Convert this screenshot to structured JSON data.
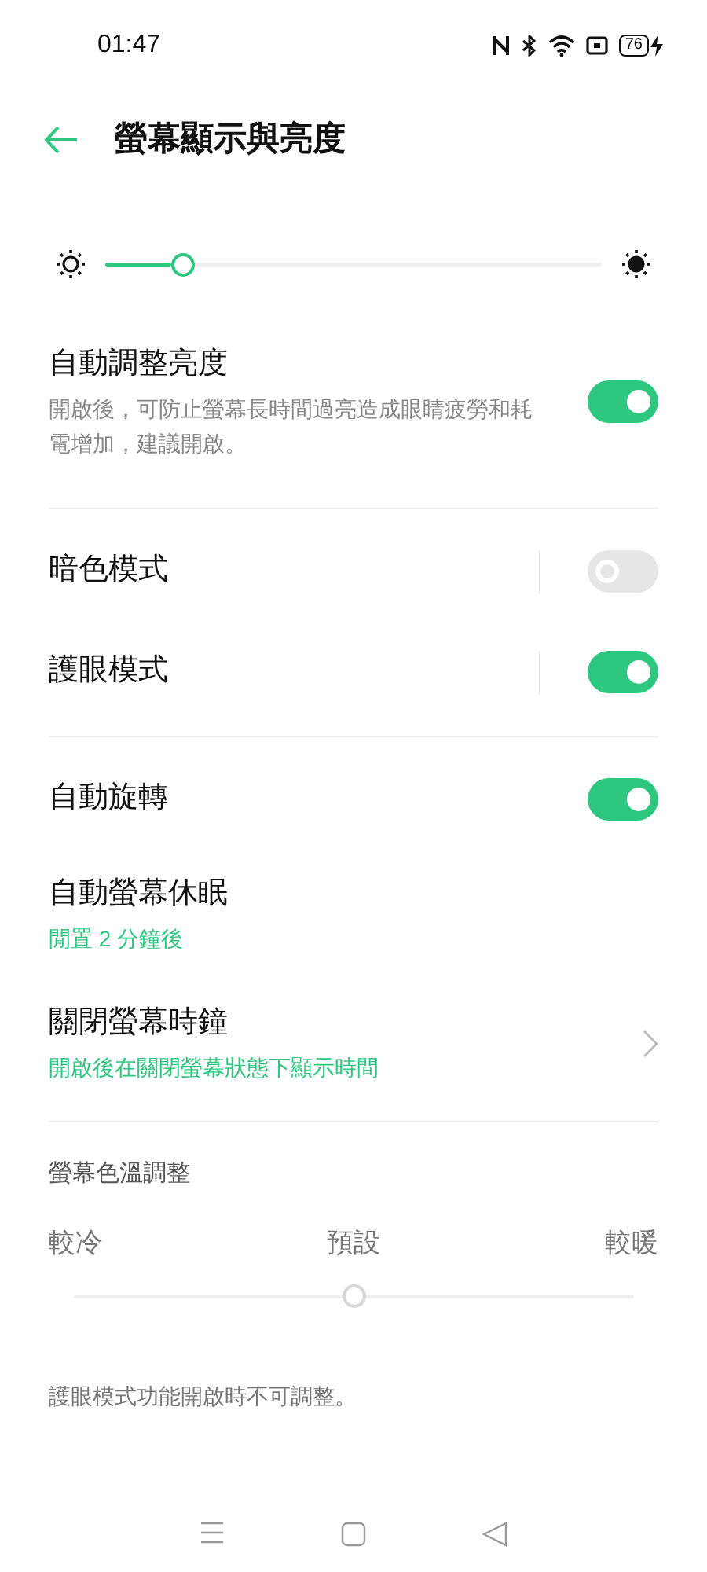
{
  "status_bar": {
    "time": "01:47",
    "battery": "76"
  },
  "header": {
    "title": "螢幕顯示與亮度"
  },
  "brightness": {
    "level": 0.155
  },
  "sections": [
    {
      "items": [
        {
          "kind": "toggle",
          "title": "自動調整亮度",
          "description": "開啟後，可防止螢幕長時間過亮造成眼睛疲勞和耗電增加，建議開啟。",
          "on": true,
          "disabled": false,
          "separator": false
        }
      ]
    },
    {
      "items": [
        {
          "kind": "toggle",
          "title": "暗色模式",
          "on": false,
          "disabled": true,
          "separator": true
        },
        {
          "kind": "toggle",
          "title": "護眼模式",
          "on": true,
          "disabled": false,
          "separator": true
        }
      ]
    },
    {
      "items": [
        {
          "kind": "toggle",
          "title": "自動旋轉",
          "on": true,
          "disabled": false,
          "separator": false
        },
        {
          "kind": "value",
          "title": "自動螢幕休眠",
          "value": "閒置 2 分鐘後"
        },
        {
          "kind": "link",
          "title": "關閉螢幕時鐘",
          "value": "開啟後在關閉螢幕狀態下顯示時間"
        }
      ]
    }
  ],
  "color_temperature": {
    "title": "螢幕色溫調整",
    "labels": [
      "較冷",
      "預設",
      "較暖"
    ],
    "level": 0.5,
    "disabled": true,
    "note": "護眼模式功能開啟時不可調整。"
  }
}
